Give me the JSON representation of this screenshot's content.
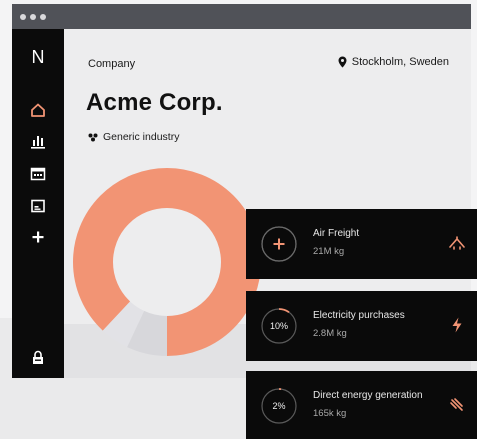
{
  "colors": {
    "accent": "#f29474",
    "accent_light": "#f6a88a",
    "sidebar_bg": "#0b0b0b",
    "card_bg": "#0a0a0a",
    "titlebar": "#505258"
  },
  "sidebar": {
    "logo": "N",
    "items": [
      {
        "icon": "home-icon",
        "active": true
      },
      {
        "icon": "bar-chart-icon",
        "active": false
      },
      {
        "icon": "calendar-icon",
        "active": false
      },
      {
        "icon": "document-icon",
        "active": false
      },
      {
        "icon": "plus-icon",
        "active": false
      }
    ],
    "bottom_icon": "lock-icon"
  },
  "header": {
    "company_label": "Company",
    "location": "Stockholm, Sweden",
    "company_name": "Acme Corp.",
    "industry": "Generic industry"
  },
  "chart_data": {
    "type": "pie",
    "style": "donut",
    "slices": [
      {
        "value": 88,
        "color": "#f29474"
      },
      {
        "value": 5,
        "color": "#e2e2e6"
      },
      {
        "value": 7,
        "color": "#d7d7db"
      }
    ]
  },
  "cards": [
    {
      "title": "Air Freight",
      "value": "21M kg",
      "ring_label": "",
      "ring_icon": "plus-icon",
      "percent": 100,
      "icon": "airplane-icon"
    },
    {
      "title": "Electricity purchases",
      "value": "2.8M kg",
      "ring_label": "10%",
      "ring_icon": "",
      "percent": 10,
      "icon": "lightning-icon"
    },
    {
      "title": "Direct energy generation",
      "value": "165k kg",
      "ring_label": "2%",
      "ring_icon": "",
      "percent": 2,
      "icon": "energy-icon"
    }
  ]
}
